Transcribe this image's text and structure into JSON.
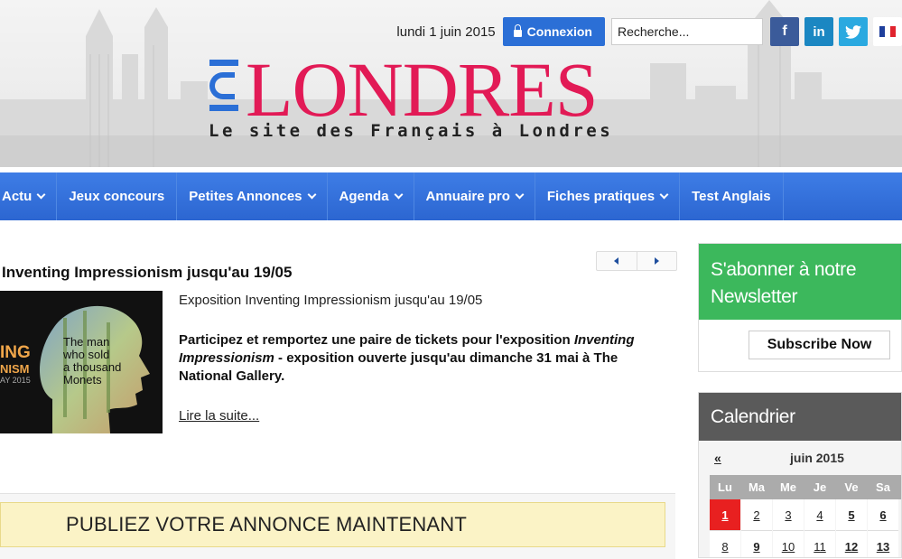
{
  "header": {
    "date": "lundi 1 juin 2015",
    "login_label": "Connexion",
    "search_placeholder": "Recherche...",
    "social": {
      "facebook": "f",
      "linkedin": "in"
    },
    "logo_prefix": "ICI",
    "logo_main": "LONDRES",
    "tagline": "Le site des Français à Londres"
  },
  "nav": {
    "items": [
      {
        "label": "Actu",
        "has_dropdown": true
      },
      {
        "label": "Jeux concours",
        "has_dropdown": false
      },
      {
        "label": "Petites Annonces",
        "has_dropdown": true
      },
      {
        "label": "Agenda",
        "has_dropdown": true
      },
      {
        "label": "Annuaire pro",
        "has_dropdown": true
      },
      {
        "label": "Fiches pratiques",
        "has_dropdown": true
      },
      {
        "label": "Test Anglais",
        "has_dropdown": false
      }
    ]
  },
  "article": {
    "title": "Inventing Impressionism jusqu'au 19/05",
    "subtitle": "Exposition Inventing Impressionism jusqu'au 19/05",
    "body_pre": "Participez et remportez une paire de tickets pour l'exposition ",
    "body_italic": "Inventing Impressionism",
    "body_post": " - exposition ouverte jusqu'au dimanche 31 mai à The National Gallery.",
    "read_more": "Lire la suite...",
    "image": {
      "line1": "ING",
      "line2": "NISM",
      "line3": "AY 2015",
      "overlay": [
        "The man",
        "who sold",
        "a thousand",
        "Monets"
      ]
    }
  },
  "annonce": {
    "label": "PUBLIEZ VOTRE ANNONCE MAINTENANT"
  },
  "newsletter": {
    "title_line1": "S'abonner à notre",
    "title_line2": "Newsletter",
    "button": "Subscribe Now"
  },
  "calendar": {
    "title": "Calendrier",
    "prev": "«",
    "month": "juin 2015",
    "weekdays": [
      "Lu",
      "Ma",
      "Me",
      "Je",
      "Ve",
      "Sa"
    ],
    "weeks": [
      [
        "1",
        "2",
        "3",
        "4",
        "5",
        "6"
      ],
      [
        "8",
        "9",
        "10",
        "11",
        "12",
        "13"
      ]
    ],
    "bold_days": [
      "5",
      "6",
      "9",
      "12",
      "13"
    ],
    "today": "1"
  },
  "colors": {
    "brand_pink": "#e21a56",
    "brand_blue": "#2b6fd6",
    "nav_blue": "#3572dc",
    "newsletter_green": "#3cb85c",
    "today_red": "#e82020"
  }
}
